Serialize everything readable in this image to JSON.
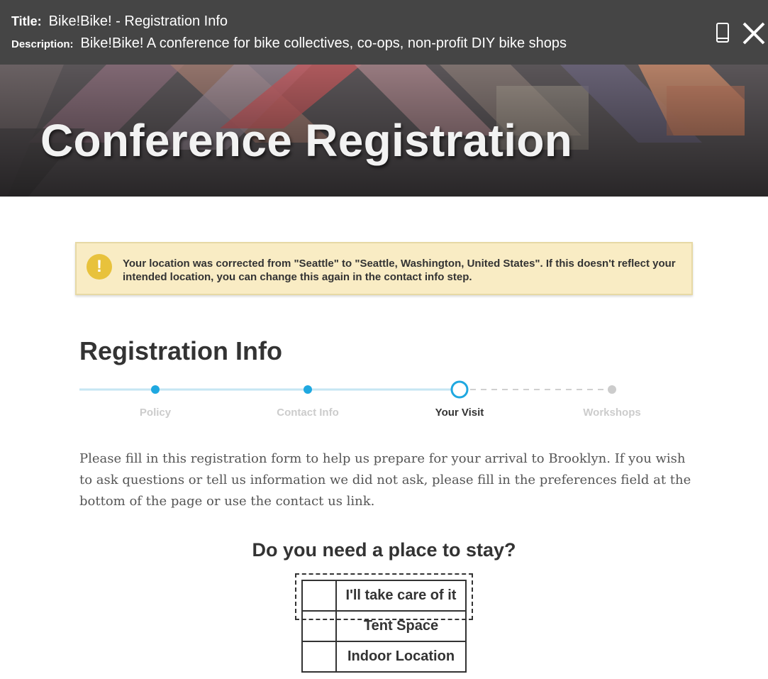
{
  "preview": {
    "title_label": "Title:",
    "title_value": "Bike!Bike! - Registration Info",
    "description_label": "Description:",
    "description_value": "Bike!Bike! A conference for bike collectives, co-ops, non-profit DIY bike shops"
  },
  "banner": {
    "title": "Conference Registration"
  },
  "alert": {
    "icon": "!",
    "message": "Your location was corrected from \"Seattle\" to \"Seattle, Washington, United States\". If this doesn't reflect your intended location, you can change this again in the contact info step."
  },
  "registration": {
    "heading": "Registration Info",
    "steps": [
      {
        "label": "Policy",
        "status": "complete"
      },
      {
        "label": "Contact Info",
        "status": "complete"
      },
      {
        "label": "Your Visit",
        "status": "current"
      },
      {
        "label": "Workshops",
        "status": "upcoming"
      }
    ],
    "intro": "Please fill in this registration form to help us prepare for your arrival to Brooklyn. If you wish to ask questions or tell us information we did not ask, please fill in the preferences field at the bottom of the page or use the contact us link.",
    "question": "Do you need a place to stay?",
    "options": [
      {
        "label": "I'll take care of it"
      },
      {
        "label": "Tent Space"
      },
      {
        "label": "Indoor Location"
      }
    ]
  },
  "colors": {
    "topbar": "#454545",
    "step_active": "#1fa8e0",
    "step_track": "#c6e6f3",
    "step_upcoming": "#cccccc",
    "alert_bg": "#f9ecc4",
    "alert_icon": "#e8c23c"
  }
}
